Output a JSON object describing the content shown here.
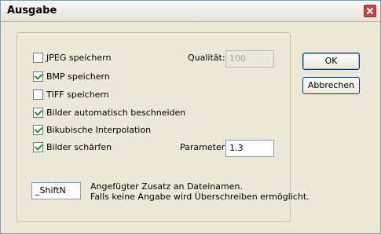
{
  "window": {
    "title": "Ausgabe"
  },
  "options": [
    {
      "label": "JPEG speichern",
      "checked": false
    },
    {
      "label": "BMP speichern",
      "checked": true
    },
    {
      "label": "TIFF speichern",
      "checked": false
    },
    {
      "label": "Bilder automatisch beschneiden",
      "checked": true
    },
    {
      "label": "Bikubische Interpolation",
      "checked": true
    },
    {
      "label": "Bilder schärfen",
      "checked": true
    }
  ],
  "quality": {
    "label": "Qualität:",
    "value": "100"
  },
  "parameter": {
    "label": "Parameter:",
    "value": "1.3"
  },
  "suffix": {
    "value": "_ShiftN",
    "description_line1": "Angefügter Zusatz an Dateinamen.",
    "description_line2": "Falls keine Angabe wird Überschreiben ermöglicht."
  },
  "buttons": {
    "ok": "OK",
    "cancel": "Abbrechen"
  }
}
